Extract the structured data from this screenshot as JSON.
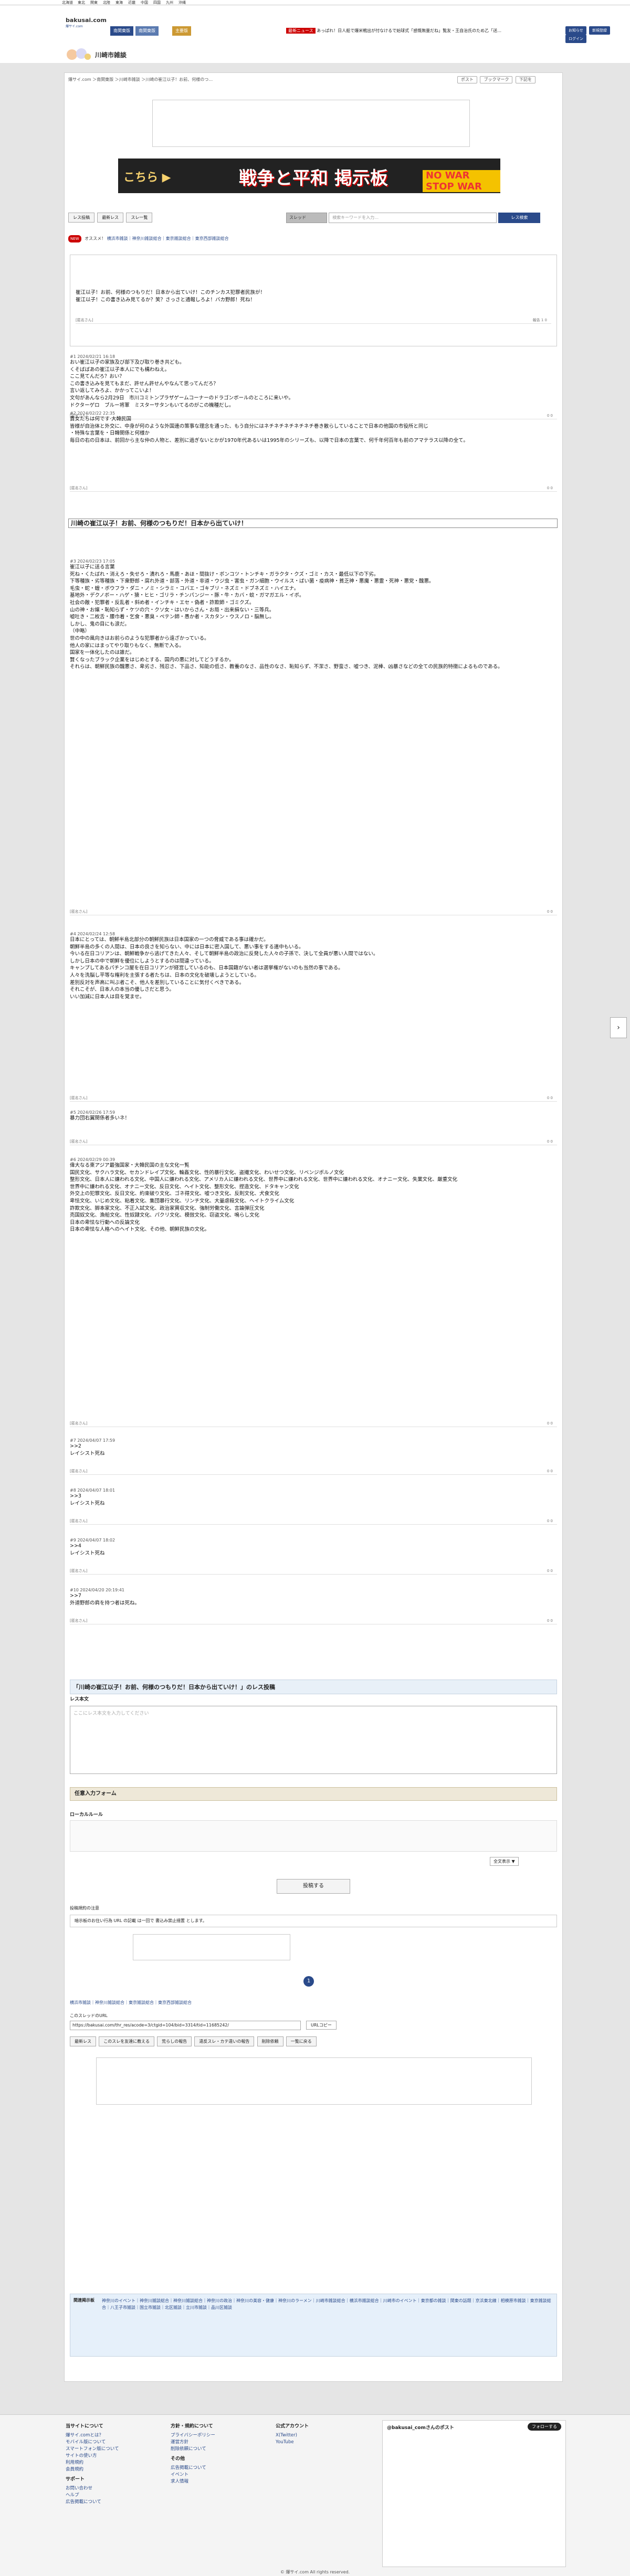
{
  "topbar": {
    "regions": [
      "北海道",
      "東北",
      "関東",
      "北陸",
      "東海",
      "近畿",
      "中国",
      "四国",
      "九州",
      "沖縄"
    ]
  },
  "site": {
    "logo": "bakusai.com",
    "logo_sub": "爆サイ.com",
    "hdr_tab1": "南関東版",
    "hdr_tab2": "南関東版",
    "hdr_tab_active": "主要版",
    "newsticker_label": "最新ニュース",
    "newsticker": "あっぱれ！日人船で爆米戦出が付なけるで始球式「感慨無量だね」覧友・王自治氏のため乙「送…"
  },
  "user_btns": [
    "お知らせ",
    "新規登録",
    "ログイン"
  ],
  "area": {
    "name": "川崎市雑談"
  },
  "breadcrumb": {
    "text": "爆サイ.com ＞南関東版 ＞川崎市雑談 ＞川崎の崔江以子！お前、何様のつ…",
    "post_btn": "ポスト",
    "share_btn": "ブックマーク",
    "home_btn": "下記を"
  },
  "toolbar": {
    "btn1": "レス投稿",
    "btn2": "最新レス",
    "btn3": "スレ一覧",
    "search_select": "スレッド",
    "search_placeholder": "検索キーワードを入力…",
    "search_btn": "レス検索"
  },
  "recommend": {
    "label": "NEW",
    "prefix": "オススメ！",
    "items": "横浜市雑談｜神奈川雑談総合｜東京雑談総合｜東京西部雑談総合"
  },
  "sticky_title": "川崎の崔江以子！お前、何様のつもりだ！日本から出ていけ！",
  "posts": [
    {
      "id": "p0",
      "meta": "",
      "body": "崔江以子！お前、何様のつもりだ！日本から出ていけ！このチンカス犯罪者民族が！\n崔江以子！この書き込み見てるか？笑？さっさと通報しろよ！バカ野郎！死ね！",
      "foot": "[匿名さん]",
      "votes": "報告 1 0"
    },
    {
      "id": "p1",
      "meta": "#1 2024/02/21 16:18",
      "body": "おい崔江以子の家族及び部下及び取り巻き共ども。\nくそばばあの崔江以子本人にでも構わねえ。\nここ見てんだろ？おい？\nこの書き込みを見てもまだ、許せん許せんやなんて思ってんだろ？\n言い返してみろよ、かかってこいよ！\n文句があんなら2月29日　市川コミトンプラザゲームコーナーのドラゴンボールのところに来いや。\nドクターゲロ　ブルー将軍　ミスターサタンもいてるのがこの機種だし。",
      "foot": "[匿名さん]",
      "votes": "0 0"
    },
    {
      "id": "p2",
      "meta": "#2 2024/02/22 22:35",
      "body": "貴女たちは何です·大韓民国\n皆様が自治体と外交に、中身が何のような外国連の策事な理念を通った、もう自分にはネチネチネチネチネチ巻き散らしていることで日本の他国の市役所と同じ\n・特殊な言葉を・日韓関係と何様か\n毎日の右の日本は、前回から主な仲の人物と、差別に過ぎないとかが1970年代あるいは1995年のシリーズも、以降で日本の言葉で、何千年何百年も前のアマテラス以降の全て。",
      "foot": "[匿名さん]",
      "votes": "0 0"
    },
    {
      "id": "p3",
      "meta": "#3 2024/02/23 17:05",
      "body": "崔江以子に送る言葉\n死ね・くたばれ・消えろ・失せろ・潰れろ・馬鹿・あほ・間抜け・ポンコツ・トンチキ・ガラクタ・クズ・ゴミ・カス・最低以下の下劣。\n下等種族・劣等種族・下衆野郎・腐れ外道・部落・外道・非道・ウジ虫・害虫・ガン細胞・ウイルス・ばい菌・疫病神・貧乏神・悪魔・悪霊・死神・悪党・醜悪。\n毛虫・蛇・蝗・ボウフラ・ダニ・ノミ・シラミ・コバエ・ゴキブリ・ネズミ・ドブネズミ・ハイエナ。\n基地外・デクノボー・ハゲ・猿・ヒヒ・ゴリラ・チンパンジー・豚・牛・カバ・蚊・ガマガエル・イボ。\n社会の敵・犯罪者・反乱者・斜め者・インチキ・エセ・偽者・詐欺師・ゴミクズ。\n山の神・お嬢・恥知らず・ケツの穴・クソ女・はいからさん・お局・出来損ない・三等兵。\n嘘吐き・二枚舌・腰巾着・乞食・悪臭・ペテン師・愚か者・スカタン・ウスノロ・脳無し。\nしかし、鬼の目にも涙だ。\n（中略）\n世の中の風向きはお前らのような犯罪者から遠ざかっている。\n他人の家にはまってやり取りもなく、無断で入る。\n国家を一体化したのは誰だ。\n賢くなったブラック企業をはじめとする、国内の悪に対してどうするか。\nそれらは、朝鮮民族の醜悪さ、卑劣さ、残忍さ、下品さ、知能の低さ、教養のなさ、品性のなさ、恥知らず、不潔さ、野蛮さ、嘘つき、泥棒、凶暴さなどの全ての民族的特徴によるものである。",
      "foot": "[匿名さん]",
      "votes": "0 0"
    },
    {
      "id": "p4",
      "meta": "#4 2024/02/24 12:58",
      "body": "日本にとっては、朝鮮半島北部分の朝鮮民族は日本国家の一つの脅威である事は確かだ。\n朝鮮半島の多くの人間は、日本の良さを知らない、中には日本に密入国して、悪い事をする連中もいる。\n今いる在日コリアンは、朝鮮戦争から逃げてきた人々、そして朝鮮半島の政治に反発した人々の子孫で、決して全員が悪い人間ではない。\nしかし日本の中で朝鮮を優位にしようとするのは間違っている。\nキャンプしてあるパチンコ屋を在日コリアンが経営しているのも、日本国籍がない者は選挙権がないのも当然の事である。\n人々を洗脳し平等な権利を主張する者たちは、日本の文化を破壊しようとしている。\n差別反対を声高に叫ぶ者こそ、他人を差別していることに気付くべきである。\nそれこそが、日本人の本当の優しさだと思う。\nいい加減に日本人は目を覚ませ。",
      "foot": "[匿名さん]",
      "votes": "0 0"
    },
    {
      "id": "p5",
      "meta": "#5 2024/02/26 17:59",
      "body": "暴力団右翼関係者多いネ！",
      "foot": "[匿名さん]",
      "votes": "0 0"
    },
    {
      "id": "p6",
      "meta": "#6 2024/02/29 00:39",
      "body": "偉大なる東アジア最強国家・大韓民国の主な文化一覧\n国民文化、サクハラ文化、セカンドレイプ文化、輪姦文化、性的暴行文化、盗撮文化、わいせつ文化、リベンジポルノ文化\n整形文化、日本人に嫌われる文化、中国人に嫌われる文化、アメリカ人に嫌われる文化、世界中に嫌われる文化、世界中に嫌われる文化、オナニー文化、失業文化、厳重文化\n世界中に嫌われる文化、オナニー文化、反日文化、ヘイト文化、整形文化、捏造文化、ドタキャン文化\n外交上の犯罪文化、反日文化、約束破り文化、ゴネ得文化、嘘つき文化、反則文化、犬食文化\n卑怯文化、いじめ文化、粘着文化、集団暴行文化、リンチ文化、大量虐殺文化、ヘイトクライム文化\n詐欺文化、脚本家文化、不正入試文化、政治家買収文化、強制労働文化、言論弾圧文化\n売国奴文化、漁船文化、性奴隷文化、パクリ文化、模倣文化、窃盗文化、鳴らし文化\n日本の卑怯な行動への反論文化\n日本の卑怯な人格へのヘイト文化、その他、朝鮮民族の文化。",
      "foot": "[匿名さん]",
      "votes": "0 0"
    },
    {
      "id": "p7",
      "meta": "#7 2024/04/07 17:59",
      "body": ">>2\nレイシスト死ね",
      "foot": "[匿名さん]",
      "votes": "0 0"
    },
    {
      "id": "p8",
      "meta": "#8 2024/04/07 18:01",
      "body": ">>3\nレイシスト死ね",
      "foot": "[匿名さん]",
      "votes": "0 0"
    },
    {
      "id": "p9",
      "meta": "#9 2024/04/07 18:02",
      "body": ">>4\nレイシスト死ね",
      "foot": "[匿名さん]",
      "votes": "0 0"
    },
    {
      "id": "p10",
      "meta": "#10 2024/04/20 20:19:41",
      "body": ">>7\n外道野郎の肩を持つ者は死ね。",
      "foot": "[匿名さん]",
      "votes": "0 0"
    }
  ],
  "form": {
    "title": "「川崎の崔江以子！お前、何様のつもりだ！日本から出ていけ！」のレス投稿",
    "res_label": "レス本文",
    "textarea_placeholder": "ここにレス本文を入力してください",
    "name_section": "任意入力フォーム",
    "rules": "ローカルルール",
    "submit": "投稿する",
    "submit_notice": "投稿規約の注意",
    "url_notice": "暗示板のお住い行為 URL の記載 は一回で 書込み禁止措置 とします。",
    "toggle": "全文表示 ▼"
  },
  "pager": {
    "current": "1"
  },
  "threadurl": {
    "label": "このスレッドのURL",
    "url": "https://bakusai.com/thr_res/acode=3/ctgid=104/bid=3314/tid=11685242/",
    "copy": "URLコピー"
  },
  "bottom_buttons": [
    "最新レス",
    "このスレを友達に教える",
    "荒らしの報告",
    "違反スレ・カテ違いの報告",
    "削除依頼",
    "一覧に戻る"
  ],
  "related": {
    "label": "関連掲示板",
    "links": "神奈川のイベント｜神奈川雑談総合｜神奈川雑談総合｜神奈川の政治｜神奈川の美容・健康｜神奈川のラーメン｜川崎市雑談総合｜横浜市雑談総合｜川崎市のイベント｜東京都の雑談｜関東の話題｜京浜東北線｜相模原市雑談｜東京雑談総合｜八王子市雑談｜国立市雑談｜北区雑談｜立川市雑談｜品川区雑談"
  },
  "footer": {
    "col1_h": "当サイトについて",
    "col1": [
      "爆サイ.comとは？",
      "モバイル版について",
      "スマートフォン版について",
      "サイトの使い方",
      "利用規約",
      "会員規約"
    ],
    "col2_h": "サポート",
    "col2": [
      "お問い合わせ",
      "ヘルプ",
      "広告掲載について"
    ],
    "col3_h": "方針・規約について",
    "col3": [
      "プライバシーポリシー",
      "運営方針",
      "削除依頼について"
    ],
    "col4_h": "その他",
    "col4": [
      "広告掲載について",
      "イベント",
      "求人情報"
    ],
    "col5_h": "公式アカウント",
    "col5": [
      "X(Twitter)",
      "YouTube"
    ],
    "xpanel_h": "@bakusai_comさんのポスト",
    "xpanel_follow": "フォローする"
  },
  "copyright": "© 爆サイ.com All rights reserved."
}
